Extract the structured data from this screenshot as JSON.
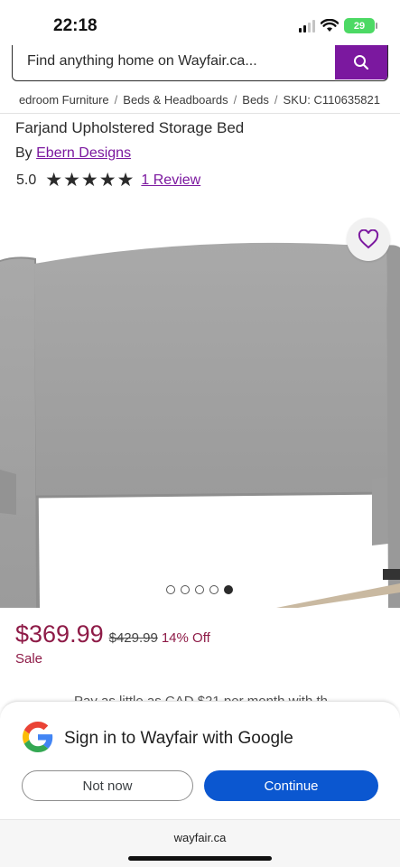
{
  "status": {
    "time": "22:18",
    "battery": "29",
    "icons": [
      "signal-icon",
      "wifi-icon",
      "battery-icon"
    ]
  },
  "search": {
    "placeholder": "Find anything home on Wayfair.ca...",
    "button_icon": "search-icon"
  },
  "breadcrumb": [
    "edroom Furniture",
    "Beds & Headboards",
    "Beds",
    "SKU: C110635821"
  ],
  "breadcrumb_separator": "/",
  "product": {
    "title": "Farjand Upholstered Storage Bed",
    "brand_prefix": "By",
    "brand": "Ebern Designs",
    "rating": "5.0",
    "stars": 5,
    "reviews_link": "1 Review",
    "image_count": 5,
    "active_image": 5,
    "favorite_icon": "heart-outline-icon"
  },
  "pricing": {
    "sale_price": "$369.99",
    "original_price": "$429.99",
    "discount": "14% Off",
    "sale_label": "Sale",
    "peek_text": "Pay as little as CAD $21 per month with th"
  },
  "signin": {
    "title": "Sign in to Wayfair with Google",
    "not_now": "Not now",
    "continue": "Continue",
    "logo": "google-logo"
  },
  "browser": {
    "url": "wayfair.ca"
  },
  "colors": {
    "brand_purple": "#7b189f",
    "price_red": "#8e1b47",
    "google_blue": "#0b57d0",
    "fabric_gray": "#a7a7a7"
  }
}
